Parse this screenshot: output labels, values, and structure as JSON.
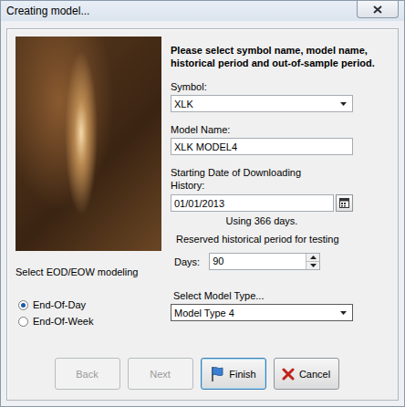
{
  "window": {
    "title": "Creating model..."
  },
  "instructions": "Please select symbol name, model name, historical period and out-of-sample period.",
  "modeling": {
    "label": "Select EOD/EOW modeling",
    "options": [
      {
        "label": "End-Of-Day",
        "selected": true
      },
      {
        "label": "End-Of-Week",
        "selected": false
      }
    ]
  },
  "symbol": {
    "label": "Symbol:",
    "value": "XLK"
  },
  "model_name": {
    "label": "Model Name:",
    "value": "XLK MODEL4"
  },
  "start_date": {
    "label": "Starting Date of Downloading History:",
    "value": "01/01/2013",
    "note": "Using 366 days."
  },
  "test_period": {
    "group_label": "Reserved historical period for testing",
    "label": "Days:",
    "value": "90"
  },
  "model_type": {
    "label": "Select Model Type...",
    "value": "Model Type 4"
  },
  "buttons": [
    {
      "label": "Back",
      "disabled": true,
      "kind": "plain"
    },
    {
      "label": "Next",
      "disabled": true,
      "kind": "plain"
    },
    {
      "label": "Finish",
      "disabled": false,
      "kind": "finish"
    },
    {
      "label": "Cancel",
      "disabled": false,
      "kind": "cancel"
    }
  ]
}
